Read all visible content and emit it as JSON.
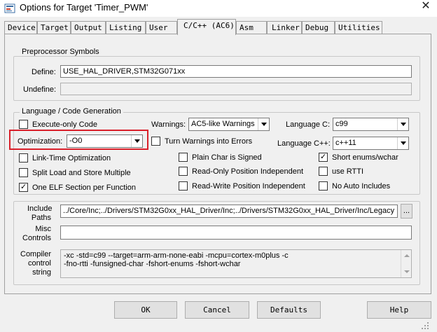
{
  "window": {
    "title": "Options for Target 'Timer_PWM'",
    "close_glyph": "✕",
    "icon": "keil-target-icon"
  },
  "tabs": [
    {
      "label": "Device"
    },
    {
      "label": "Target"
    },
    {
      "label": "Output"
    },
    {
      "label": "Listing"
    },
    {
      "label": "User"
    },
    {
      "label": "C/C++ (AC6)",
      "active": true
    },
    {
      "label": "Asm"
    },
    {
      "label": "Linker"
    },
    {
      "label": "Debug"
    },
    {
      "label": "Utilities"
    }
  ],
  "preprocessor": {
    "title": "Preprocessor Symbols",
    "define_label": "Define:",
    "define_value": "USE_HAL_DRIVER,STM32G071xx",
    "undefine_label": "Undefine:",
    "undefine_value": ""
  },
  "language": {
    "title": "Language / Code Generation",
    "execute_only": {
      "label": "Execute-only Code",
      "checked": false
    },
    "warnings_label": "Warnings:",
    "warnings_value": "AC5-like Warnings",
    "lang_c_label": "Language C:",
    "lang_c_value": "c99",
    "optimization_label": "Optimization:",
    "optimization_value": "-O0",
    "turn_warnings": {
      "label": "Turn Warnings into Errors",
      "checked": false
    },
    "lang_cpp_label": "Language C++:",
    "lang_cpp_value": "c++11",
    "link_time": {
      "label": "Link-Time Optimization",
      "checked": false
    },
    "plain_char": {
      "label": "Plain Char is Signed",
      "checked": false
    },
    "short_enums": {
      "label": "Short enums/wchar",
      "checked": true
    },
    "split_load": {
      "label": "Split Load and Store Multiple",
      "checked": false
    },
    "ro_pos": {
      "label": "Read-Only Position Independent",
      "checked": false
    },
    "use_rtti": {
      "label": "use RTTI",
      "checked": false
    },
    "one_elf": {
      "label": "One ELF Section per Function",
      "checked": true
    },
    "rw_pos": {
      "label": "Read-Write Position Independent",
      "checked": false
    },
    "no_auto": {
      "label": "No Auto Includes",
      "checked": false
    }
  },
  "paths": {
    "include_label_1": "Include",
    "include_label_2": "Paths",
    "include_value": "../Core/Inc;../Drivers/STM32G0xx_HAL_Driver/Inc;../Drivers/STM32G0xx_HAL_Driver/Inc/Legacy",
    "browse_label": "...",
    "misc_label_1": "Misc",
    "misc_label_2": "Controls",
    "misc_value": "",
    "compiler_label_1": "Compiler",
    "compiler_label_2": "control",
    "compiler_label_3": "string",
    "compiler_value": "-xc -std=c99 --target=arm-arm-none-eabi -mcpu=cortex-m0plus -c\n-fno-rtti -funsigned-char -fshort-enums -fshort-wchar"
  },
  "buttons": {
    "ok": "OK",
    "cancel": "Cancel",
    "defaults": "Defaults",
    "help": "Help"
  }
}
